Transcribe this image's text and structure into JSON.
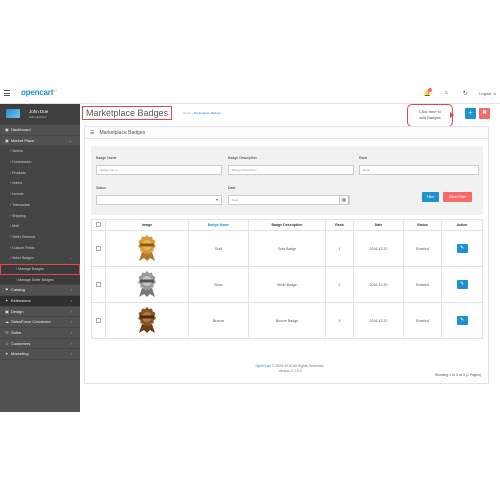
{
  "header": {
    "logo_text": "opencart",
    "logo_sub": "2.2",
    "logout_label": "Logout",
    "icons": [
      "menu-icon",
      "bell-icon",
      "home-icon",
      "refresh-icon",
      "logout-icon"
    ]
  },
  "profile": {
    "name": "John Doe",
    "role": "Administrator"
  },
  "sidebar": {
    "items": [
      {
        "label": "Dashboard",
        "level": 0,
        "icon": "dashboard-icon"
      },
      {
        "label": "Market Place",
        "level": 0,
        "icon": "market-icon",
        "expanded": true
      },
      {
        "label": "Sellers",
        "level": 1
      },
      {
        "label": "Commission",
        "level": 1
      },
      {
        "label": "Products",
        "level": 1
      },
      {
        "label": "orders",
        "level": 1
      },
      {
        "label": "Income",
        "level": 1
      },
      {
        "label": "Transaction",
        "level": 1
      },
      {
        "label": "Shipping",
        "level": 1
      },
      {
        "label": "Mail",
        "level": 1
      },
      {
        "label": "Seller Reviews",
        "level": 1
      },
      {
        "label": "Custom Fields",
        "level": 1
      },
      {
        "label": "Seller Badges",
        "level": 1,
        "expanded": true
      },
      {
        "label": "Manage Badges",
        "level": 2,
        "active": true
      },
      {
        "label": "Manage Seller Badges",
        "level": 2
      },
      {
        "label": "Catalog",
        "level": 0,
        "icon": "tag-icon"
      },
      {
        "label": "Extensions",
        "level": 0,
        "icon": "puzzle-icon",
        "dark": true
      },
      {
        "label": "Design",
        "level": 0,
        "icon": "monitor-icon"
      },
      {
        "label": "SalesForce Connector",
        "level": 0,
        "icon": "cloud-icon"
      },
      {
        "label": "Sales",
        "level": 0,
        "icon": "cart-icon"
      },
      {
        "label": "Customers",
        "level": 0,
        "icon": "user-icon"
      },
      {
        "label": "Marketing",
        "level": 0,
        "icon": "share-icon"
      }
    ]
  },
  "page": {
    "title": "Marketplace Badges",
    "breadcrumb": [
      "Home",
      "Marketplace Badges"
    ],
    "callout": "Click here to add Badges"
  },
  "panel": {
    "heading": "Marketplace Badges"
  },
  "filter": {
    "badge_name_label": "Badge Name",
    "badge_name_placeholder": "Badge Name",
    "badge_desc_label": "Badge Description",
    "badge_desc_placeholder": "Badge Description",
    "rank_label": "Rank",
    "rank_placeholder": "Rank",
    "status_label": "Status",
    "status_value": "",
    "date_label": "Date",
    "date_placeholder": "Date",
    "filter_button": "Filter",
    "clear_button": "Clear Filter"
  },
  "table": {
    "columns": [
      "",
      "Image",
      "Badge Name",
      "Badge Description",
      "Rank",
      "Date",
      "Status",
      "Action"
    ],
    "rows": [
      {
        "name": "Gold",
        "description": "Gold Badge",
        "rank": "1",
        "date": "2016-12-20",
        "status": "Enabled",
        "color": "#d79a3a"
      },
      {
        "name": "Silver",
        "description": "Silver Badge",
        "rank": "2",
        "date": "2016-12-20",
        "status": "Enabled",
        "color": "#9a9a9a"
      },
      {
        "name": "Bronze",
        "description": "Bronze Badge",
        "rank": "3",
        "date": "2016-12-20",
        "status": "Enabled",
        "color": "#8a5524"
      }
    ],
    "showing": "Showing 1 to 3 of 3 (1 Pages)"
  },
  "footer": {
    "link": "OpenCart",
    "copyright": "© 2009-2016 All Rights Reserved.",
    "version": "Version 2.2.0.0"
  },
  "colors": {
    "accent": "#1e91cf",
    "danger": "#f56b6b",
    "highlight": "#e0484e",
    "sidebar": "#515151"
  }
}
